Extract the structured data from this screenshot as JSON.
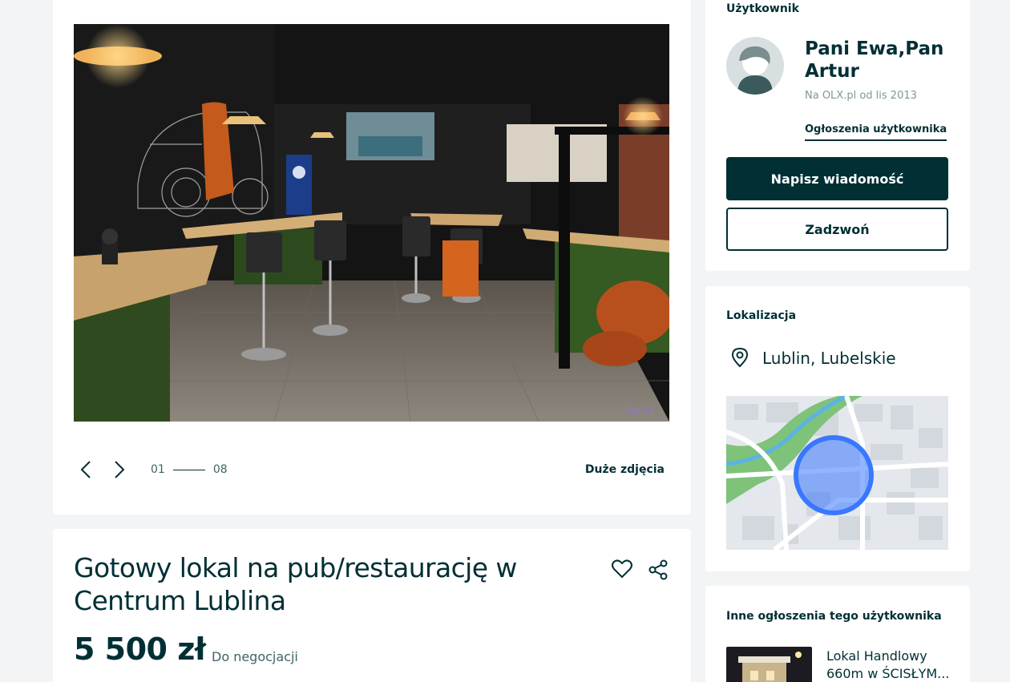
{
  "gallery": {
    "watermark": "PACO",
    "counter_current": "01",
    "counter_total": "08",
    "big_photos_label": "Duże zdjęcia"
  },
  "ad": {
    "title": "Gotowy lokal na pub/restaurację w Centrum Lublina",
    "price": "5 500 zł",
    "negotiable": "Do negocjacji"
  },
  "user": {
    "section_label": "Użytkownik",
    "name": "Pani Ewa,Pan Artur",
    "member_since": "Na OLX.pl od lis 2013",
    "ads_link": "Ogłoszenia użytkownika",
    "message_button": "Napisz wiadomość",
    "call_button": "Zadzwoń"
  },
  "location": {
    "section_label": "Lokalizacja",
    "place": "Lublin, Lubelskie"
  },
  "other_ads": {
    "section_label": "Inne ogłoszenia tego użytkownika",
    "items": [
      {
        "title": "Lokal Handlowy 660m w ŚCISŁYM..."
      }
    ]
  },
  "colors": {
    "primary": "#002f34",
    "background": "#f2f4f5",
    "muted": "#7f9799",
    "map_circle": "#3a77ff"
  },
  "icons": [
    "chevron-left-icon",
    "chevron-right-icon",
    "heart-icon",
    "share-icon",
    "location-pin-icon",
    "avatar-icon"
  ]
}
